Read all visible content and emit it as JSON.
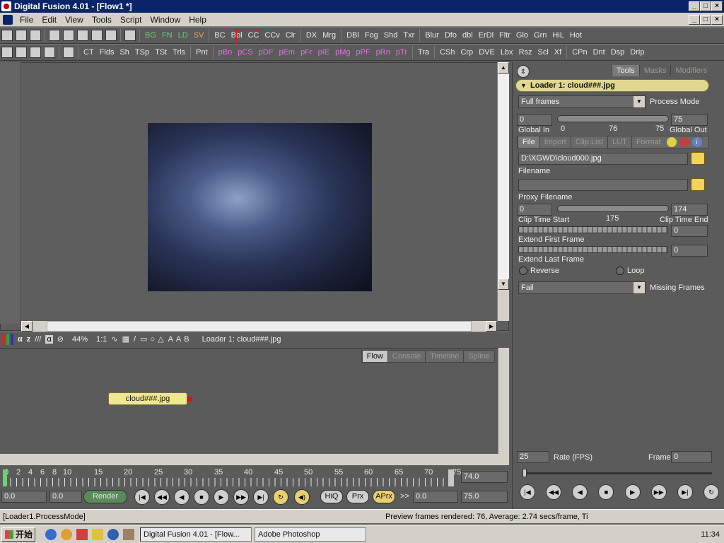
{
  "window": {
    "title": "Digital Fusion 4.01 - [Flow1 *]"
  },
  "menu": [
    "File",
    "Edit",
    "View",
    "Tools",
    "Script",
    "Window",
    "Help"
  ],
  "toolbar1": {
    "groupA": [
      "BG",
      "FN",
      "LD",
      "SV"
    ],
    "groupB": [
      "BC",
      "Bol",
      "CC",
      "CCv",
      "Clr"
    ],
    "groupC": [
      "DX",
      "Mrg"
    ],
    "groupD": [
      "DBl",
      "Fog",
      "Shd",
      "Txr"
    ],
    "groupE": [
      "Blur",
      "Dfo",
      "dbl",
      "ErDl",
      "Fltr",
      "Glo",
      "Grn",
      "HiL",
      "Hot"
    ]
  },
  "toolbar2": {
    "groupA": [
      "CT",
      "Flds",
      "Sh",
      "TSp",
      "TSt",
      "Trls"
    ],
    "groupB": [
      "Pnt"
    ],
    "groupC": [
      "pBn",
      "pCS",
      "pDF",
      "pEm",
      "pFr",
      "pIE",
      "pMg",
      "pPF",
      "pRn",
      "pTr"
    ],
    "groupD": [
      "Tra"
    ],
    "groupE": [
      "CSh",
      "Crp",
      "DVE",
      "Lbx",
      "Rsz",
      "Scl",
      "Xf"
    ],
    "groupF": [
      "CPn",
      "Dnt",
      "Dsp",
      "Drip"
    ]
  },
  "viewer": {
    "zoom": "44%",
    "ratio": "1:1",
    "label": "Loader 1: cloud###.jpg"
  },
  "flow": {
    "tabs": [
      "Flow",
      "Console",
      "Timeline",
      "Spline"
    ],
    "node_label": "cloud###.jpg"
  },
  "tools_panel": {
    "tabs": [
      "Tools",
      "Masks",
      "Modifiers"
    ],
    "header": "Loader 1: cloud###.jpg",
    "process_mode_value": "Full frames",
    "process_mode_label": "Process Mode",
    "global_in_value": "0",
    "global_out_value": "75",
    "global_in_label": "Global In",
    "global_out_label": "Global Out",
    "global_ticks": [
      "0",
      "76",
      "75"
    ],
    "subtabs": [
      "File",
      "Import",
      "Clip List",
      "LUT",
      "Format"
    ],
    "filename_value": "D:\\XGWD\\cloud000.jpg",
    "filename_label": "Filename",
    "proxy_label": "Proxy Filename",
    "clip_start_value": "0",
    "clip_end_value": "174",
    "clip_mid": "175",
    "clip_start_label": "Clip Time Start",
    "clip_end_label": "Clip Time End",
    "extend_first_value": "0",
    "extend_first_label": "Extend First Frame",
    "extend_last_value": "0",
    "extend_last_label": "Extend Last Frame",
    "reverse_label": "Reverse",
    "loop_label": "Loop",
    "missing_value": "Fail",
    "missing_label": "Missing Frames"
  },
  "playback": {
    "rate_value": "25",
    "rate_label": "Rate (FPS)",
    "frame_label": "Frame",
    "frame_value": "0"
  },
  "timeline": {
    "ticks": [
      "0",
      "2",
      "4",
      "6",
      "8",
      "10",
      "15",
      "20",
      "25",
      "30",
      "35",
      "40",
      "45",
      "50",
      "55",
      "60",
      "65",
      "70",
      "75"
    ],
    "current": "74.0",
    "start_field": "0.0",
    "start_field2": "0.0",
    "render_label": "Render",
    "hiq": "HiQ",
    "prx": "Prx",
    "aprx": "APrx",
    "chev": ">>",
    "end_field": "0.0",
    "end_total": "75.0"
  },
  "status": {
    "left": "[Loader1.ProcessMode]",
    "right": "Preview frames rendered: 76,  Average: 2.74 secs/frame,  Ti"
  },
  "taskbar": {
    "start": "开始",
    "tasks": [
      "Digital Fusion 4.01 - [Flow...",
      "Adobe Photoshop"
    ],
    "clock": "11:34"
  },
  "colors": {
    "highlight_box": "#e01818",
    "node": "#f0e890",
    "title_bg": "#0a246a"
  }
}
